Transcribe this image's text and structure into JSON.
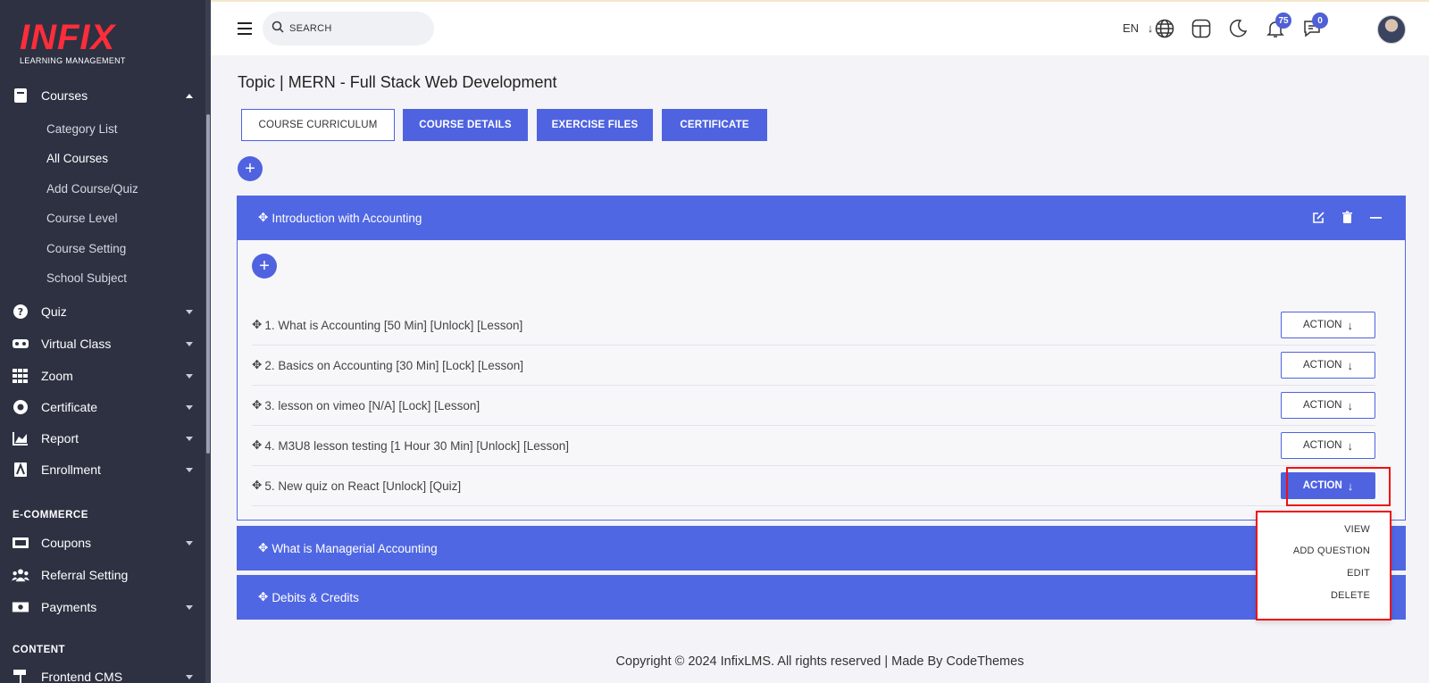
{
  "sidebar": {
    "logo_text": "INFIX",
    "logo_tagline": "LEARNING MANAGEMENT",
    "courses_label": "Courses",
    "sub_items": [
      "Category List",
      "All Courses",
      "Add Course/Quiz",
      "Course Level",
      "Course Setting",
      "School Subject"
    ],
    "active_sub": "All Courses",
    "items": [
      "Quiz",
      "Virtual Class",
      "Zoom",
      "Certificate",
      "Report",
      "Enrollment"
    ],
    "ecommerce_title": "E-COMMERCE",
    "ecommerce_items": [
      "Coupons",
      "Referral Setting",
      "Payments"
    ],
    "content_title": "CONTENT",
    "content_items": [
      "Frontend CMS"
    ]
  },
  "header": {
    "search_placeholder": "SEARCH",
    "language": "EN",
    "notification_count": "75",
    "message_count": "0"
  },
  "main": {
    "title": "Topic | MERN - Full Stack Web Development",
    "tabs": [
      "COURSE CURRICULUM",
      "COURSE DETAILS",
      "EXERCISE FILES",
      "CERTIFICATE"
    ],
    "sections": [
      {
        "title": "Introduction with Accounting",
        "lessons": [
          "1. What is Accounting [50 Min] [Unlock] [Lesson]",
          "2. Basics on Accounting [30 Min] [Lock] [Lesson]",
          "3. lesson on vimeo [N/A] [Lock] [Lesson]",
          "4. M3U8 lesson testing [1 Hour 30 Min] [Unlock] [Lesson]",
          "5. New quiz on React [Unlock] [Quiz]"
        ]
      },
      {
        "title": "What is Managerial Accounting"
      },
      {
        "title": "Debits & Credits"
      }
    ],
    "action_label": "ACTION",
    "dropdown_options": [
      "VIEW",
      "ADD QUESTION",
      "EDIT",
      "DELETE"
    ]
  },
  "footer": {
    "copyright": "Copyright © 2024 InfixLMS. All rights reserved | Made By CodeThemes"
  }
}
